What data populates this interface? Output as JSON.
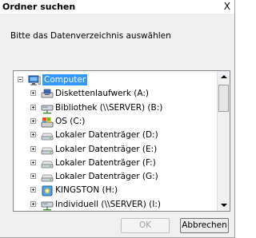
{
  "window": {
    "title": "Ordner suchen",
    "close_glyph": "X"
  },
  "instruction": "Bitte das Datenverzeichnis auswählen",
  "tree": {
    "items": [
      {
        "label": "Computer",
        "icon": "computer-icon",
        "expander": "minus",
        "level": 0,
        "selected": true
      },
      {
        "label": "Diskettenlaufwerk (A:)",
        "icon": "floppy-drive-icon",
        "expander": "plus",
        "level": 1,
        "selected": false
      },
      {
        "label": "Bibliothek (\\\\SERVER) (B:)",
        "icon": "network-drive-icon",
        "expander": "plus",
        "level": 1,
        "selected": false
      },
      {
        "label": "OS (C:)",
        "icon": "system-drive-icon",
        "expander": "plus",
        "level": 1,
        "selected": false
      },
      {
        "label": "Lokaler Datenträger (D:)",
        "icon": "hard-drive-icon",
        "expander": "plus",
        "level": 1,
        "selected": false
      },
      {
        "label": "Lokaler Datenträger (E:)",
        "icon": "hard-drive-icon",
        "expander": "plus",
        "level": 1,
        "selected": false
      },
      {
        "label": "Lokaler Datenträger (F:)",
        "icon": "hard-drive-icon",
        "expander": "plus",
        "level": 1,
        "selected": false
      },
      {
        "label": "Lokaler Datenträger (G:)",
        "icon": "hard-drive-icon",
        "expander": "plus",
        "level": 1,
        "selected": false
      },
      {
        "label": "KINGSTON (H:)",
        "icon": "usb-drive-icon",
        "expander": "plus",
        "level": 1,
        "selected": false
      },
      {
        "label": "Individuell (\\\\SERVER) (I:)",
        "icon": "network-drive-icon",
        "expander": "plus",
        "level": 1,
        "selected": false
      }
    ]
  },
  "buttons": {
    "ok": "OK",
    "cancel": "Abbrechen",
    "ok_enabled": false
  },
  "colors": {
    "selection": "#3399ff",
    "dialog_bg": "#f0f0f0"
  }
}
